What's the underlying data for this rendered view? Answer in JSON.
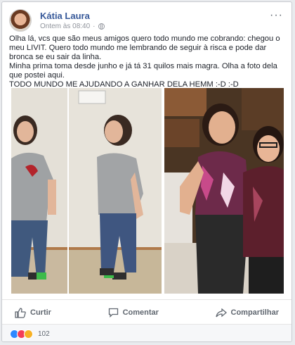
{
  "post": {
    "author": "Kátia Laura",
    "timestamp": "Ontem às 08:40",
    "privacy_icon": "globe-icon",
    "more_icon": "more-options-icon",
    "text_lines": [
      "Olha lá, vcs que são meus amigos quero todo mundo me cobrando: chegou o meu LIVIT. Quero todo mundo me lembrando de seguir à risca e pode dar bronca se eu sair da linha.",
      "Minha prima toma desde junho e já tá 31 quilos mais magra. Olha a foto dela que postei aqui.",
      "TODO MUNDO ME AJUDANDO A GANHAR DELA HEMM :-D :-D"
    ]
  },
  "actions": {
    "like": "Curtir",
    "comment": "Comentar",
    "share": "Compartilhar"
  },
  "reactions": {
    "count": "102",
    "icons": [
      "like-icon",
      "love-icon",
      "wow-icon"
    ],
    "colors": {
      "like": "#2d88ff",
      "love": "#f33e58",
      "wow": "#f7b125"
    }
  },
  "colors": {
    "name_link": "#365899",
    "meta_text": "#90949c",
    "action_text": "#606770",
    "background": "#e9ebee"
  }
}
